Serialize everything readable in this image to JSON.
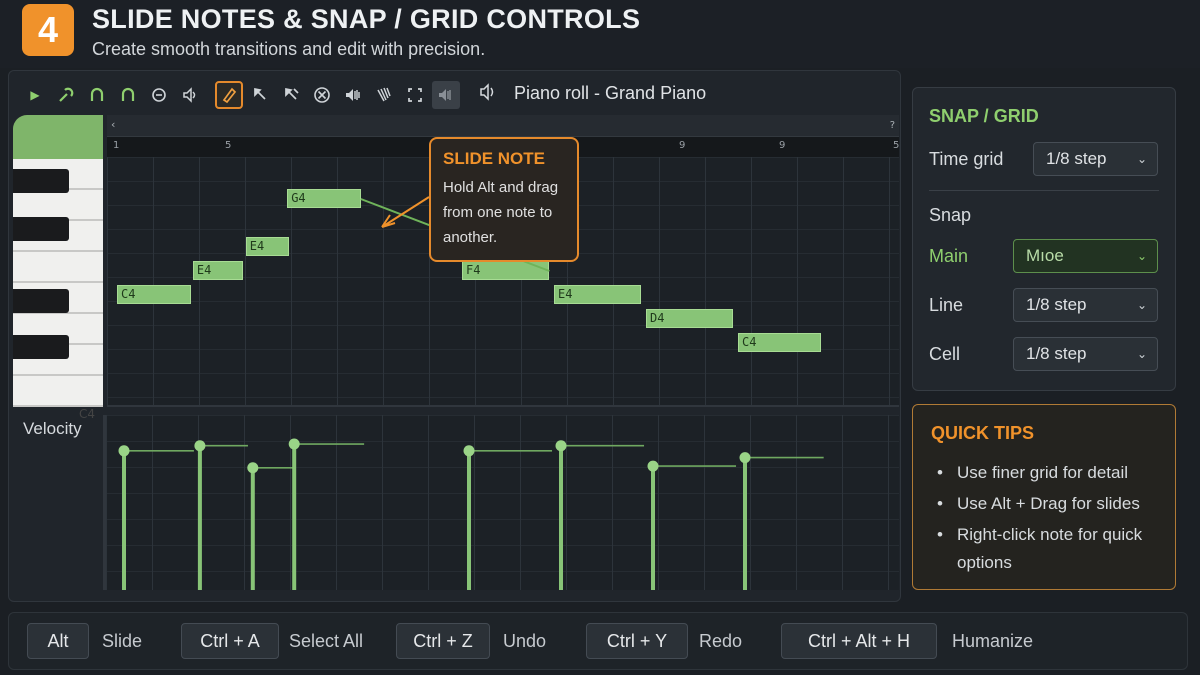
{
  "header": {
    "step": "4",
    "title": "SLIDE NOTES & SNAP / GRID CONTROLS",
    "subtitle": "Create smooth transitions and edit with precision."
  },
  "toolbar": {
    "icons": [
      "play-arrow-icon",
      "magnet-icon",
      "loop-icon",
      "loop-icon",
      "metronome-icon",
      "speaker-icon",
      "pencil-icon",
      "paint-brush-icon",
      "delete-brush-icon",
      "mute-circle-icon",
      "volume-icon",
      "slice-icon",
      "select-icon",
      "mute-speaker-icon"
    ],
    "piano_roll_title": "Piano roll - Grand Piano"
  },
  "piano": {
    "octave_label": "C4"
  },
  "ruler": {
    "marks": [
      "1",
      "5",
      "",
      "",
      "",
      "",
      "9",
      "9",
      "5"
    ]
  },
  "notes": [
    {
      "label": "C4",
      "start": 0,
      "length": 1.6,
      "row": 6
    },
    {
      "label": "E4",
      "start": 1.65,
      "length": 1.1,
      "row": 5
    },
    {
      "label": "E4",
      "start": 2.8,
      "length": 0.95,
      "row": 4
    },
    {
      "label": "G4",
      "start": 3.7,
      "length": 1.6,
      "row": 2
    },
    {
      "label": "F4",
      "start": 7.5,
      "length": 1.9,
      "row": 5
    },
    {
      "label": "E4",
      "start": 9.5,
      "length": 1.9,
      "row": 6
    },
    {
      "label": "D4",
      "start": 11.5,
      "length": 1.9,
      "row": 7
    },
    {
      "label": "C4",
      "start": 13.5,
      "length": 1.8,
      "row": 8
    }
  ],
  "callout": {
    "title": "SLIDE NOTE",
    "body": "Hold Alt and drag from one note to another."
  },
  "velocity": {
    "label": "Velocity",
    "values": [
      0.82,
      0.85,
      0.72,
      0.86,
      0.82,
      0.85,
      0.73,
      0.78
    ]
  },
  "snap_panel": {
    "title": "SNAP / GRID",
    "time_grid_label": "Time grid",
    "time_grid_value": "1/8 step",
    "snap_label": "Snap",
    "main_label": "Main",
    "main_value": "Mıoe",
    "line_label": "Line",
    "line_value": "1/8 step",
    "cell_label": "Cell",
    "cell_value": "1/8 step"
  },
  "tips_panel": {
    "title": "QUICK TIPS",
    "tips": [
      "Use finer grid for detail",
      "Use Alt + Drag for slides",
      "Right-click note for quick options"
    ]
  },
  "shortcuts": [
    {
      "key": "Alt",
      "desc": "Slide"
    },
    {
      "key": "Ctrl + A",
      "desc": "Select All"
    },
    {
      "key": "Ctrl + Z",
      "desc": "Undo"
    },
    {
      "key": "Ctrl + Y",
      "desc": "Redo"
    },
    {
      "key": "Ctrl + Alt + H",
      "desc": "Humanize"
    }
  ],
  "colors": {
    "accent_orange": "#f0922b",
    "note_green": "#88c477",
    "text_green": "#8fcf6e"
  }
}
